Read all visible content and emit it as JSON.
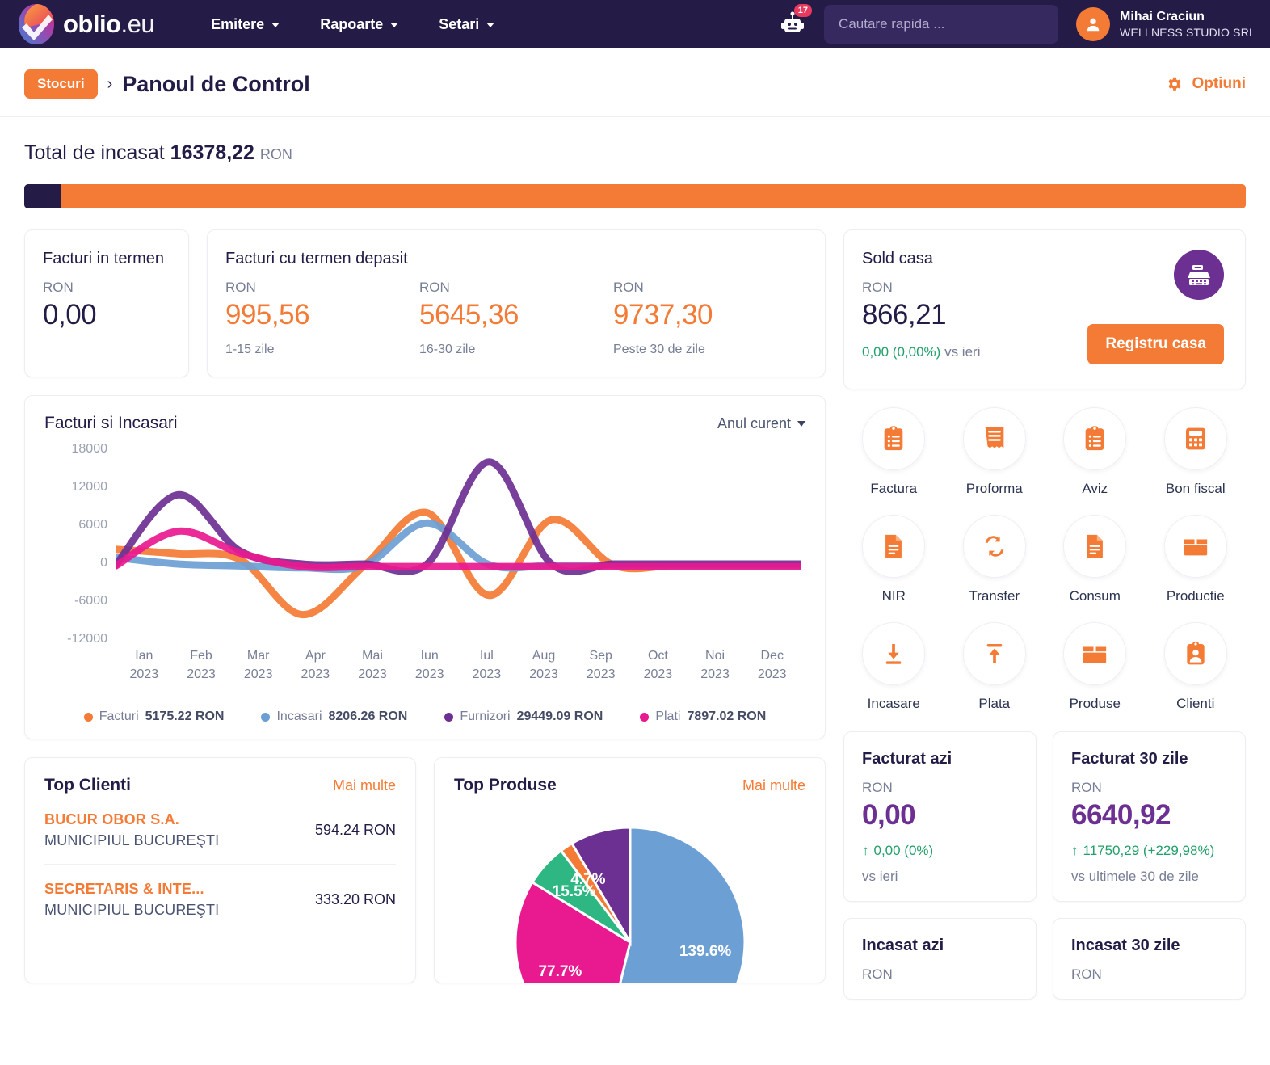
{
  "header": {
    "brand_name": "oblio",
    "brand_tld": ".eu",
    "nav": [
      {
        "label": "Emitere",
        "icon": "chevron-down-icon"
      },
      {
        "label": "Rapoarte",
        "icon": "chevron-down-icon"
      },
      {
        "label": "Setari",
        "icon": "chevron-down-icon"
      }
    ],
    "bot_badge": "17",
    "search_placeholder": "Cautare rapida ...",
    "search_value": "",
    "user_name": "Mihai Craciun",
    "user_org": "WELLNESS STUDIO SRL"
  },
  "breadcrumb": {
    "pill": "Stocuri",
    "separator": "›",
    "title": "Panoul de Control",
    "options_label": "Optiuni"
  },
  "total": {
    "prefix": "Total de incasat",
    "amount": "16378,22",
    "currency": "RON",
    "progress_dark_pct": 3
  },
  "cards": {
    "in_termen": {
      "title": "Facturi in termen",
      "currency": "RON",
      "value": "0,00"
    },
    "depasit": {
      "title": "Facturi cu termen depasit",
      "buckets": [
        {
          "currency": "RON",
          "value": "995,56",
          "label": "1-15 zile"
        },
        {
          "currency": "RON",
          "value": "5645,36",
          "label": "16-30 zile"
        },
        {
          "currency": "RON",
          "value": "9737,30",
          "label": "Peste 30 de zile"
        }
      ]
    },
    "sold_casa": {
      "title": "Sold casa",
      "currency": "RON",
      "value": "866,21",
      "delta": "0,00 (0,00%)",
      "delta_suffix": "vs ieri",
      "button": "Registru casa",
      "icon": "cash-register-icon"
    }
  },
  "chart_card": {
    "title": "Facturi si Incasari",
    "range_label": "Anul curent",
    "legend": [
      {
        "name": "Facturi",
        "value": "5175.22 RON",
        "color": "#F47B35"
      },
      {
        "name": "Incasari",
        "value": "8206.26 RON",
        "color": "#6C9FD4"
      },
      {
        "name": "Furnizori",
        "value": "29449.09 RON",
        "color": "#6C2F92"
      },
      {
        "name": "Plati",
        "value": "7897.02 RON",
        "color": "#E9198F"
      }
    ]
  },
  "chart_data": [
    {
      "type": "line",
      "title": "Facturi si Incasari",
      "xlabel": "",
      "ylabel": "",
      "ylim": [
        -12000,
        18000
      ],
      "yticks": [
        18000,
        12000,
        6000,
        0,
        -6000,
        -12000
      ],
      "categories": [
        "Ian",
        "Feb",
        "Mar",
        "Apr",
        "Mai",
        "Iun",
        "Iul",
        "Aug",
        "Sep",
        "Oct",
        "Noi",
        "Dec"
      ],
      "category_year": "2023",
      "grid": false,
      "legend_position": "bottom",
      "series": [
        {
          "name": "Facturi",
          "color": "#F47B35",
          "values": [
            1900,
            1200,
            300,
            -8300,
            -600,
            7600,
            -5300,
            6500,
            -600,
            -600,
            -600,
            -600
          ]
        },
        {
          "name": "Incasari",
          "color": "#6C9FD4",
          "values": [
            600,
            -400,
            -700,
            -1000,
            -600,
            6000,
            -500,
            -600,
            -600,
            -600,
            -600,
            -600
          ]
        },
        {
          "name": "Furnizori",
          "color": "#6C2F92",
          "values": [
            -600,
            10400,
            1600,
            -400,
            -400,
            -400,
            15500,
            -400,
            -400,
            -400,
            -400,
            -400
          ]
        },
        {
          "name": "Plati",
          "color": "#E9198F",
          "values": [
            -700,
            4700,
            1300,
            -800,
            -800,
            -800,
            -800,
            -800,
            -800,
            -800,
            -800,
            -800
          ]
        }
      ]
    },
    {
      "type": "pie",
      "title": "Top Produse",
      "labels": [
        "139.6%",
        "77.7%",
        "15.5%",
        "4.7%",
        ""
      ],
      "values": [
        139.6,
        77.7,
        15.5,
        4.7,
        22.0
      ],
      "colors": [
        "#6C9FD4",
        "#E9198F",
        "#2FB783",
        "#F47B35",
        "#6C2F92"
      ],
      "legend_position": "none"
    }
  ],
  "actions": [
    {
      "label": "Factura",
      "icon": "clipboard-list-icon"
    },
    {
      "label": "Proforma",
      "icon": "receipt-icon"
    },
    {
      "label": "Aviz",
      "icon": "clipboard-list-icon"
    },
    {
      "label": "Bon fiscal",
      "icon": "calculator-icon"
    },
    {
      "label": "NIR",
      "icon": "document-lines-icon"
    },
    {
      "label": "Transfer",
      "icon": "refresh-arrows-icon"
    },
    {
      "label": "Consum",
      "icon": "document-lines-icon"
    },
    {
      "label": "Productie",
      "icon": "box-icon"
    },
    {
      "label": "Incasare",
      "icon": "download-arrow-icon"
    },
    {
      "label": "Plata",
      "icon": "upload-arrow-icon"
    },
    {
      "label": "Produse",
      "icon": "box-icon"
    },
    {
      "label": "Clienti",
      "icon": "id-badge-icon"
    }
  ],
  "stats": [
    {
      "title": "Facturat azi",
      "currency": "RON",
      "value": "0,00",
      "delta": "0,00 (0%)",
      "vs": "vs ieri",
      "arrow": "↑"
    },
    {
      "title": "Facturat 30 zile",
      "currency": "RON",
      "value": "6640,92",
      "delta": "11750,29 (+229,98%)",
      "vs": "vs ultimele 30 de zile",
      "arrow": "↑"
    },
    {
      "title": "Incasat azi",
      "currency": "RON",
      "value": "",
      "delta": "",
      "vs": "",
      "arrow": ""
    },
    {
      "title": "Incasat 30 zile",
      "currency": "RON",
      "value": "",
      "delta": "",
      "vs": "",
      "arrow": ""
    }
  ],
  "top_clienti": {
    "title": "Top Clienti",
    "more": "Mai multe",
    "rows": [
      {
        "name": "BUCUR OBOR S.A.",
        "city": "MUNICIPIUL BUCUREŞTI",
        "value": "594.24 RON"
      },
      {
        "name": "SECRETARIS & INTE...",
        "city": "MUNICIPIUL BUCUREŞTI",
        "value": "333.20 RON"
      }
    ]
  },
  "top_produse": {
    "title": "Top Produse",
    "more": "Mai multe"
  },
  "colors": {
    "navy": "#241C47",
    "orange": "#F47B35",
    "purple": "#6C2F92",
    "green": "#22A06B",
    "blue": "#6C9FD4",
    "magenta": "#E9198F"
  }
}
